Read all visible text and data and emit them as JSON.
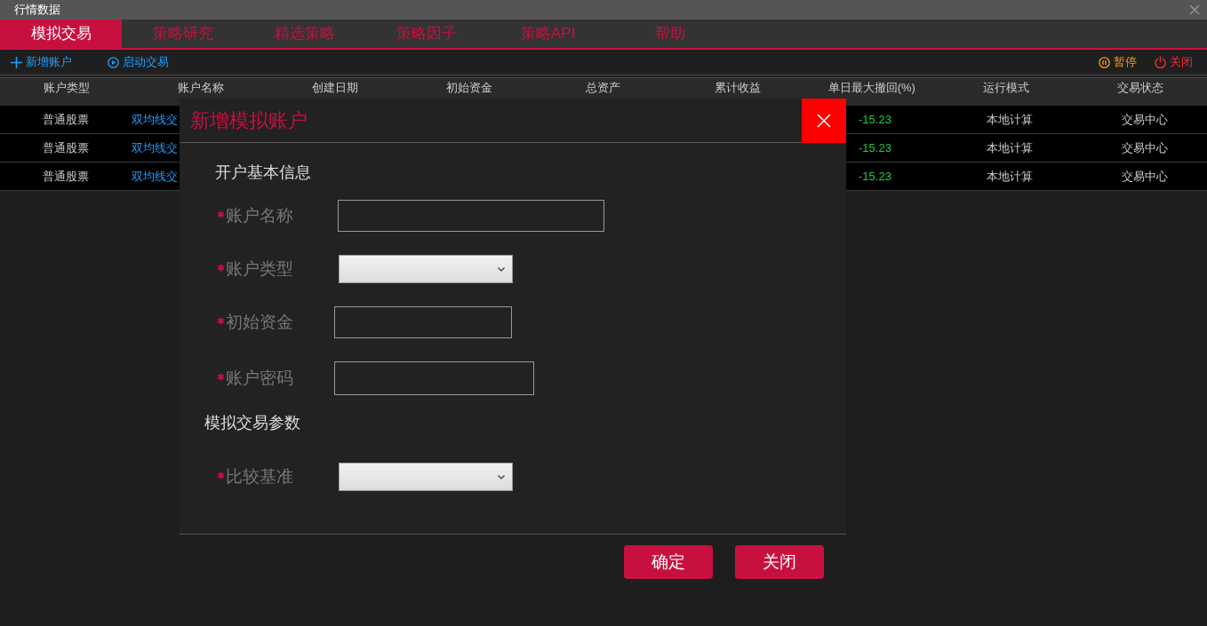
{
  "window": {
    "title": "行情数据"
  },
  "tabs": [
    {
      "label": "模拟交易",
      "selected": true
    },
    {
      "label": "策略研究",
      "selected": false
    },
    {
      "label": "精选策略",
      "selected": false
    },
    {
      "label": "策略因子",
      "selected": false
    },
    {
      "label": "策略API",
      "selected": false
    },
    {
      "label": "帮助",
      "selected": false
    }
  ],
  "toolbar": {
    "left": [
      {
        "kind": "add",
        "label": "新增账户"
      },
      {
        "kind": "play",
        "label": "启动交易"
      }
    ],
    "right": [
      {
        "kind": "pause",
        "label": "暂停"
      },
      {
        "kind": "power",
        "label": "关闭"
      }
    ]
  },
  "table": {
    "columns": [
      "账户类型",
      "账户名称",
      "创建日期",
      "初始资金",
      "总资产",
      "累计收益",
      "单日最大撤回(%)",
      "运行模式",
      "交易状态"
    ],
    "rows": [
      {
        "account_type": "普通股票",
        "account_name": "双均线交",
        "max_drawdown": "-15.23",
        "run_mode": "本地计算",
        "trade_status": "交易中心"
      },
      {
        "account_type": "普通股票",
        "account_name": "双均线交",
        "max_drawdown": "-15.23",
        "run_mode": "本地计算",
        "trade_status": "交易中心"
      },
      {
        "account_type": "普通股票",
        "account_name": "双均线交",
        "max_drawdown": "-15.23",
        "run_mode": "本地计算",
        "trade_status": "交易中心"
      }
    ]
  },
  "dialog": {
    "title": "新增模拟账户",
    "sections": [
      {
        "heading": "开户基本信息",
        "fields": [
          {
            "kind": "text",
            "label": "账户名称",
            "required": true
          },
          {
            "kind": "select",
            "label": "账户类型",
            "required": true
          },
          {
            "kind": "text",
            "label": "初始资金",
            "required": true
          },
          {
            "kind": "password",
            "label": "账户密码",
            "required": true
          }
        ]
      },
      {
        "heading": "模拟交易参数",
        "fields": [
          {
            "kind": "select",
            "label": "比较基准",
            "required": true
          }
        ]
      }
    ],
    "buttons": [
      "确定",
      "关闭"
    ]
  }
}
